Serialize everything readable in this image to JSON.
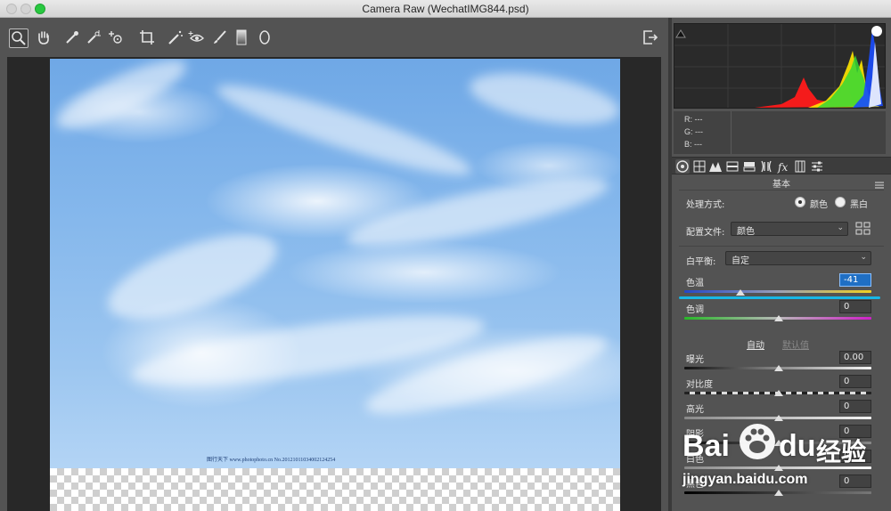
{
  "window": {
    "title": "Camera Raw (WechatIMG844.psd)"
  },
  "toolbar": {
    "tools": [
      "zoom-icon",
      "hand-icon",
      "eyedropper-icon",
      "color-sampler-icon",
      "targeted-adjustment-icon",
      "crop-icon",
      "spot-removal-icon",
      "red-eye-icon",
      "adjustment-brush-icon",
      "graduated-filter-icon",
      "radial-filter-icon"
    ],
    "exit_icon": "open-object-icon"
  },
  "image": {
    "watermark": "图行天下 www.photophoto.cn No.20121011034002124254"
  },
  "histogram": {
    "colors": [
      "#ff1a1a",
      "#ffe600",
      "#35d835",
      "#1a4dff",
      "#ffffff"
    ]
  },
  "readout": {
    "r": "R:  ---",
    "g": "G:  ---",
    "b": "B:  ---"
  },
  "panel": {
    "title": "基本",
    "process_label": "处理方式:",
    "process_color": "颜色",
    "process_bw": "黑白",
    "profile_label": "配置文件:",
    "profile_value": "颜色",
    "wb_label": "白平衡:",
    "wb_value": "自定",
    "temp_label": "色温",
    "temp_value": "-41",
    "tint_label": "色调",
    "tint_value": "0",
    "auto": "自动",
    "default": "默认值",
    "exposure_label": "曝光",
    "exposure_value": "0.00",
    "contrast_label": "对比度",
    "contrast_value": "0",
    "highlights_label": "高光",
    "highlights_value": "0",
    "shadows_label": "阴影",
    "shadows_value": "0",
    "whites_label": "白色",
    "whites_value": "0",
    "blacks_label": "黑色",
    "blacks_value": "0"
  },
  "overlay": {
    "baidu_text": "Bai",
    "baidu_du": "du",
    "baidu_cn": "经验",
    "baidu_url": "jingyan.baidu.com"
  }
}
